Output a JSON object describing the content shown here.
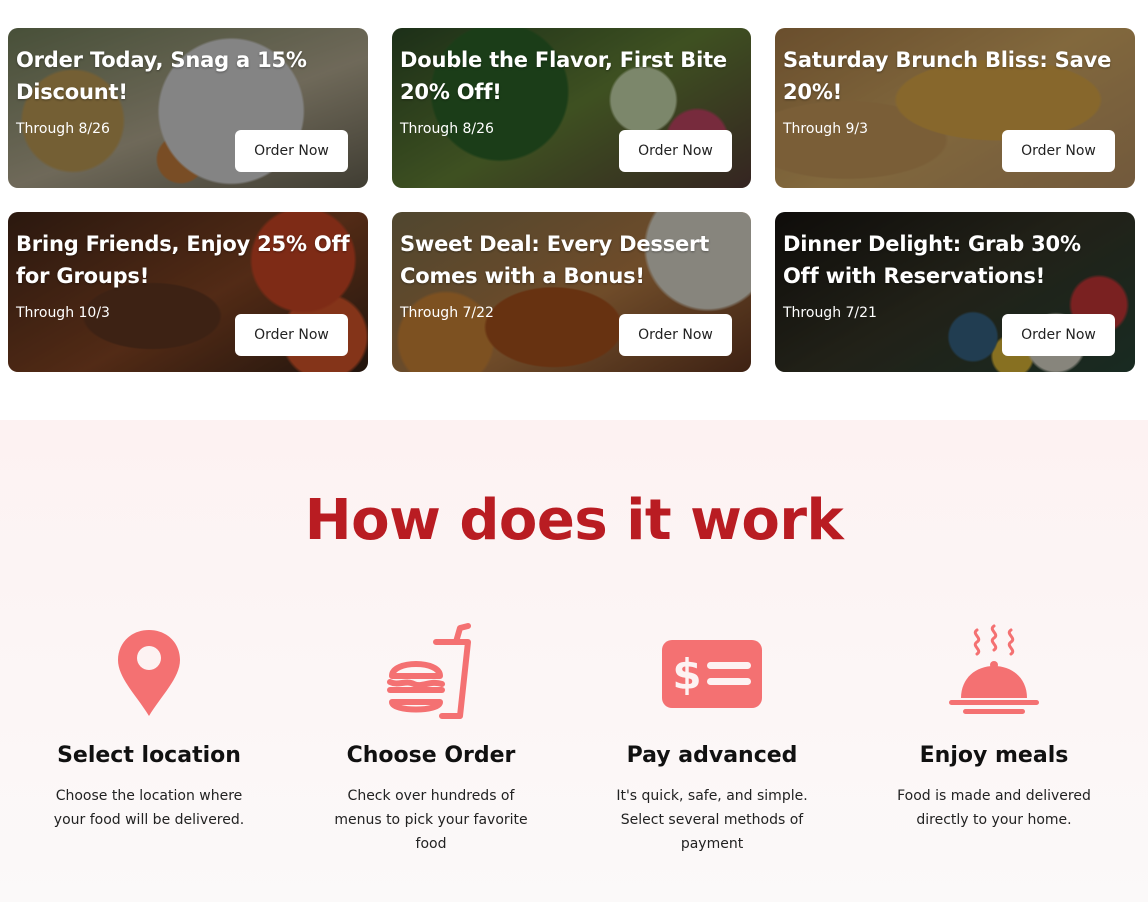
{
  "offers": [
    {
      "title": "Order Today, Snag a 15% Discount!",
      "through": "Through 8/26",
      "button": "Order Now"
    },
    {
      "title": "Double the Flavor, First Bite 20% Off!",
      "through": "Through 8/26",
      "button": "Order Now"
    },
    {
      "title": "Saturday Brunch Bliss: Save 20%!",
      "through": "Through 9/3",
      "button": "Order Now"
    },
    {
      "title": "Bring Friends, Enjoy 25% Off for Groups!",
      "through": "Through 10/3",
      "button": "Order Now"
    },
    {
      "title": "Sweet Deal: Every Dessert Comes with a Bonus!",
      "through": "Through 7/22",
      "button": "Order Now"
    },
    {
      "title": "Dinner Delight: Grab 30% Off with Reservations!",
      "through": "Through 7/21",
      "button": "Order Now"
    }
  ],
  "how": {
    "title": "How does it work",
    "steps": [
      {
        "icon": "map-pin-icon",
        "title": "Select location",
        "desc": "Choose the location where your food will be delivered."
      },
      {
        "icon": "burger-drink-icon",
        "title": "Choose Order",
        "desc": "Check over hundreds of menus to pick your favorite food"
      },
      {
        "icon": "dollar-card-icon",
        "title": "Pay advanced",
        "desc": "It's quick, safe, and simple. Select several methods of payment"
      },
      {
        "icon": "cloche-icon",
        "title": "Enjoy meals",
        "desc": "Food is made and delivered directly to your home."
      }
    ]
  },
  "colors": {
    "accent": "#b91c22",
    "icon": "#f47172",
    "section_bg": "#fdf2f2"
  }
}
